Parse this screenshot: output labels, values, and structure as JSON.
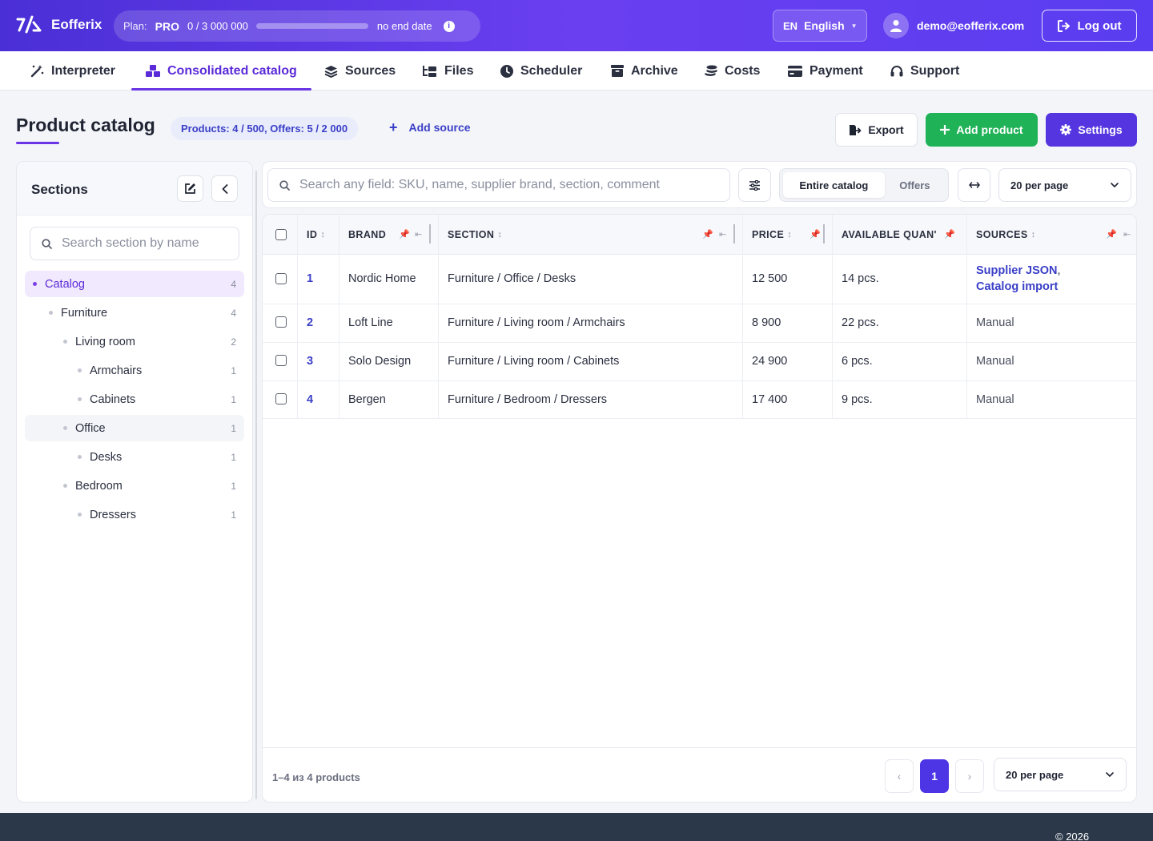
{
  "app": {
    "name": "Eofferix"
  },
  "plan": {
    "label": "Plan:",
    "tier": "PRO",
    "usage": "0 / 3 000 000",
    "progress_fraction": 0.0,
    "end": "no end date",
    "info": "i"
  },
  "lang": {
    "code": "EN",
    "name": "English"
  },
  "user": {
    "email": "demo@eofferix.com"
  },
  "logout": "Log out",
  "nav": [
    "Interpreter",
    "Consolidated catalog",
    "Sources",
    "Files",
    "Scheduler",
    "Archive",
    "Costs",
    "Payment",
    "Support"
  ],
  "page": {
    "title": "Product catalog",
    "badge": "Products: 4 / 500, Offers: 5 / 2 000",
    "add_source": "Add source",
    "export": "Export",
    "add_product": "Add product",
    "settings": "Settings"
  },
  "sidebar": {
    "title": "Sections",
    "search_placeholder": "Search section by name",
    "items": [
      {
        "label": "Catalog",
        "count": "4"
      },
      {
        "label": "Furniture",
        "count": "4"
      },
      {
        "label": "Living room",
        "count": "2"
      },
      {
        "label": "Armchairs",
        "count": "1"
      },
      {
        "label": "Cabinets",
        "count": "1"
      },
      {
        "label": "Office",
        "count": "1"
      },
      {
        "label": "Desks",
        "count": "1"
      },
      {
        "label": "Bedroom",
        "count": "1"
      },
      {
        "label": "Dressers",
        "count": "1"
      }
    ]
  },
  "toolbar": {
    "search_placeholder": "Search any field: SKU, name, supplier brand, section, comment",
    "seg_catalog": "Entire catalog",
    "seg_offers": "Offers",
    "per_page": "20 per page"
  },
  "table": {
    "headers": {
      "id": "ID",
      "brand": "BRAND",
      "section": "SECTION",
      "price": "PRICE",
      "qty": "AVAILABLE QUAN'",
      "sources": "SOURCES"
    },
    "rows": [
      {
        "id": "1",
        "brand": "Nordic Home",
        "section": "Furniture / Office / Desks",
        "price": "12 500",
        "qty": "14 pcs.",
        "src1": "Supplier JSON",
        "src_sep": ",",
        "src2": "Catalog import"
      },
      {
        "id": "2",
        "brand": "Loft Line",
        "section": "Furniture / Living room / Armchairs",
        "price": "8 900",
        "qty": "22 pcs.",
        "src": "Manual"
      },
      {
        "id": "3",
        "brand": "Solo Design",
        "section": "Furniture / Living room / Cabinets",
        "price": "24 900",
        "qty": "6 pcs.",
        "src": "Manual"
      },
      {
        "id": "4",
        "brand": "Bergen",
        "section": "Furniture / Bedroom / Dressers",
        "price": "17 400",
        "qty": "9 pcs.",
        "src": "Manual"
      }
    ]
  },
  "footer_bar": {
    "summary": "1–4 из 4 products",
    "prev": "‹",
    "page": "1",
    "next": "›",
    "per_page": "20 per page"
  },
  "copyright": "© 2026"
}
